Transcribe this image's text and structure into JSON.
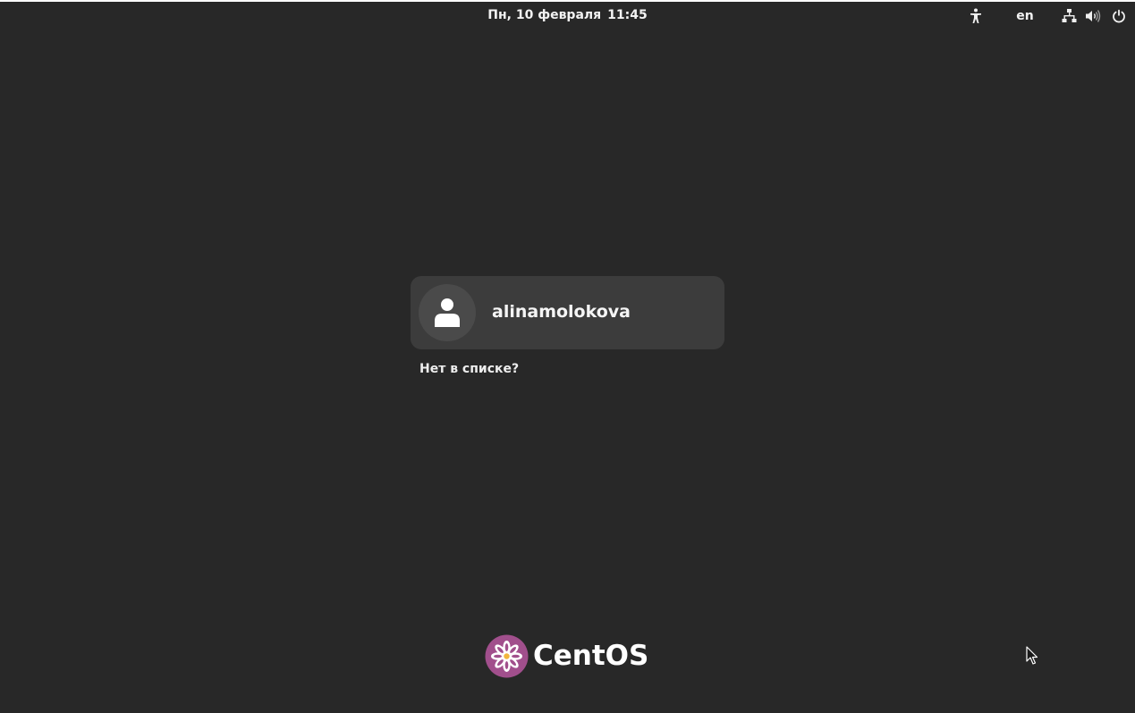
{
  "top_bar": {
    "date": "Пн, 10 февраля",
    "time": "11:45",
    "tray": {
      "accessibility_icon": "accessibility-icon",
      "language": "en",
      "network_icon": "network-wired-icon",
      "volume_icon": "volume-icon",
      "power_icon": "power-icon"
    }
  },
  "login": {
    "users": [
      {
        "name": "alinamolokova",
        "avatar_icon": "user-avatar-icon"
      }
    ],
    "not_listed_label": "Нет в списке?"
  },
  "branding": {
    "logo_icon": "centos-logo-icon",
    "name": "CentOS"
  },
  "colors": {
    "background": "#282828",
    "card": "#3c3c3c",
    "avatar": "#4a4a4a",
    "text": "#ffffff",
    "logo_purple": "#a14f8c"
  }
}
